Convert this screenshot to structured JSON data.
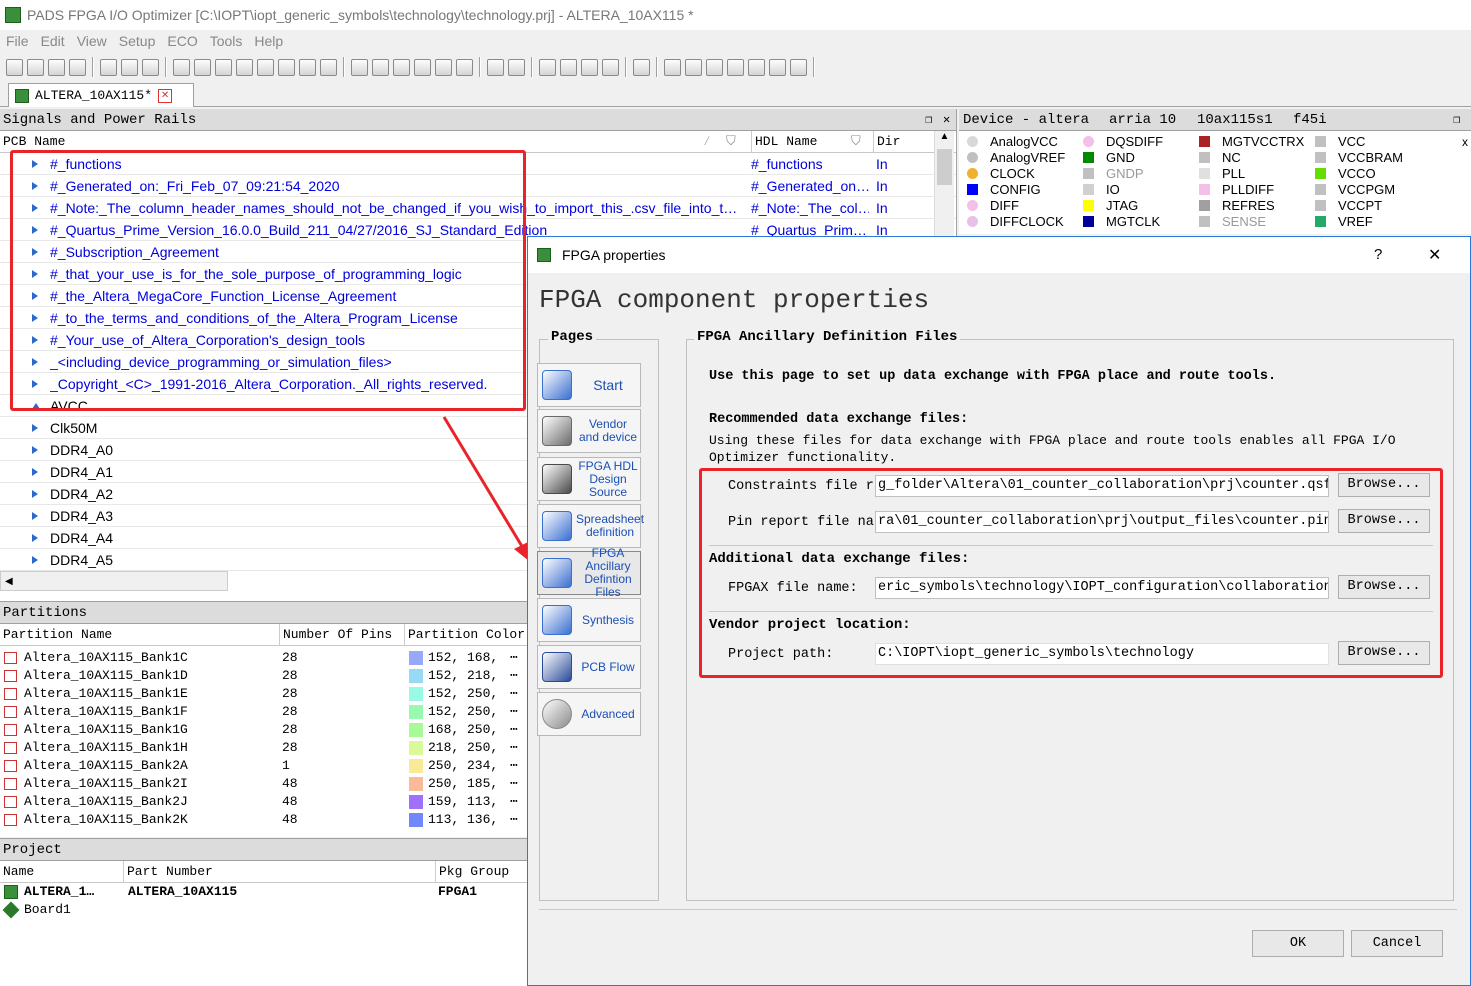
{
  "window": {
    "title": "PADS FPGA I/O Optimizer [C:\\IOPT\\iopt_generic_symbols\\technology\\technology.prj] - ALTERA_10AX115 *"
  },
  "menu": [
    "File",
    "Edit",
    "View",
    "Setup",
    "ECO",
    "Tools",
    "Help"
  ],
  "doc_tab": {
    "label": "ALTERA_10AX115*"
  },
  "signals_panel": {
    "title": "Signals and Power Rails",
    "col_pcb": "PCB Name",
    "col_hdl": "HDL Name",
    "col_dir": "Dir",
    "rows": [
      {
        "name": "#_functions",
        "hdl": "#_functions",
        "dir": "In"
      },
      {
        "name": "#_Generated_on:_Fri_Feb_07_09:21:54_2020",
        "hdl": "#_Generated_on…",
        "dir": "In"
      },
      {
        "name": "#_Note:_The_column_header_names_should_not_be_changed_if_you_wish_to_import_this_.csv_file_into_t…",
        "hdl": "#_Note:_The_col…",
        "dir": "In"
      },
      {
        "name": "#_Quartus_Prime_Version_16.0.0_Build_211_04/27/2016_SJ_Standard_Edition",
        "hdl": "#_Quartus_Prim…",
        "dir": "In"
      },
      {
        "name": "#_Subscription_Agreement",
        "hdl": "",
        "dir": ""
      },
      {
        "name": "#_that_your_use_is_for_the_sole_purpose_of_programming_logic",
        "hdl": "",
        "dir": ""
      },
      {
        "name": "#_the_Altera_MegaCore_Function_License_Agreement",
        "hdl": "",
        "dir": ""
      },
      {
        "name": "#_to_the_terms_and_conditions_of_the_Altera_Program_License",
        "hdl": "",
        "dir": ""
      },
      {
        "name": "#_Your_use_of_Altera_Corporation's_design_tools",
        "hdl": "",
        "dir": ""
      },
      {
        "name": "_<including_device_programming_or_simulation_files>",
        "hdl": "",
        "dir": ""
      },
      {
        "name": "_Copyright_<C>_1991-2016_Altera_Corporation._All_rights_reserved.",
        "hdl": "",
        "dir": ""
      },
      {
        "name": "AVCC",
        "hdl": "",
        "dir": ""
      },
      {
        "name": "Clk50M",
        "hdl": "",
        "dir": ""
      },
      {
        "name": "DDR4_A0",
        "hdl": "",
        "dir": ""
      },
      {
        "name": "DDR4_A1",
        "hdl": "",
        "dir": ""
      },
      {
        "name": "DDR4_A2",
        "hdl": "",
        "dir": ""
      },
      {
        "name": "DDR4_A3",
        "hdl": "",
        "dir": ""
      },
      {
        "name": "DDR4_A4",
        "hdl": "",
        "dir": ""
      },
      {
        "name": "DDR4_A5",
        "hdl": "",
        "dir": ""
      }
    ]
  },
  "device_panel": {
    "title": "Device - altera",
    "family": "arria 10",
    "part": "10ax115s1",
    "package": "f45i",
    "close": "x",
    "legend": [
      {
        "label": "AnalogVCC",
        "color": "#d8d8d8"
      },
      {
        "label": "AnalogVREF",
        "color": "#c0c0c0"
      },
      {
        "label": "CLOCK",
        "color": "#f0b030"
      },
      {
        "label": "CONFIG",
        "color": "#0000ff"
      },
      {
        "label": "DIFF",
        "color": "#f4c0e8"
      },
      {
        "label": "DIFFCLOCK",
        "color": "#e8c0e8"
      },
      {
        "label": "DQSDIFF",
        "color": "#f4c0e8"
      },
      {
        "label": "GND",
        "color": "#008800"
      },
      {
        "label": "GNDP",
        "color": "#c0c0c0"
      },
      {
        "label": "IO",
        "color": "#d0d0d0"
      },
      {
        "label": "JTAG",
        "color": "#ffff00"
      },
      {
        "label": "MGTCLK",
        "color": "#000099"
      },
      {
        "label": "MGTVCCTRX",
        "color": "#aa2222"
      },
      {
        "label": "NC",
        "color": "#c0c0c0"
      },
      {
        "label": "PLL",
        "color": "#e0e0e0"
      },
      {
        "label": "PLLDIFF",
        "color": "#f4c0e8"
      },
      {
        "label": "REFRES",
        "color": "#a0a0a0"
      },
      {
        "label": "SENSE",
        "color": "#c0c0c0"
      },
      {
        "label": "VCC",
        "color": "#c0c0c0"
      },
      {
        "label": "VCCBRAM",
        "color": "#c0c0c0"
      },
      {
        "label": "VCCO",
        "color": "#66dd00"
      },
      {
        "label": "VCCPGM",
        "color": "#c0c0c0"
      },
      {
        "label": "VCCPT",
        "color": "#c0c0c0"
      },
      {
        "label": "VREF",
        "color": "#22aa66"
      }
    ]
  },
  "partitions_panel": {
    "title": "Partitions",
    "col_name": "Partition Name",
    "col_pins": "Number Of Pins",
    "col_color": "Partition Color",
    "rows": [
      {
        "name": "Altera_10AX115_Bank1C",
        "pins": "28",
        "color_text": "152,  168,",
        "color": "#98a8fa"
      },
      {
        "name": "Altera_10AX115_Bank1D",
        "pins": "28",
        "color_text": "152,  218,",
        "color": "#98daf4"
      },
      {
        "name": "Altera_10AX115_Bank1E",
        "pins": "28",
        "color_text": "152,  250,",
        "color": "#98fae4"
      },
      {
        "name": "Altera_10AX115_Bank1F",
        "pins": "28",
        "color_text": "152,  250,",
        "color": "#98fab0"
      },
      {
        "name": "Altera_10AX115_Bank1G",
        "pins": "28",
        "color_text": "168,  250,",
        "color": "#a8fa98"
      },
      {
        "name": "Altera_10AX115_Bank1H",
        "pins": "28",
        "color_text": "218,  250,",
        "color": "#dafa98"
      },
      {
        "name": "Altera_10AX115_Bank2A",
        "pins": "1",
        "color_text": "250,  234,",
        "color": "#faea98"
      },
      {
        "name": "Altera_10AX115_Bank2I",
        "pins": "48",
        "color_text": "250,  185,",
        "color": "#fab998"
      },
      {
        "name": "Altera_10AX115_Bank2J",
        "pins": "48",
        "color_text": "159,  113,",
        "color": "#9f71fa"
      },
      {
        "name": "Altera_10AX115_Bank2K",
        "pins": "48",
        "color_text": "113,  136,",
        "color": "#7188fa"
      }
    ]
  },
  "project_panel": {
    "title": "Project",
    "col_name": "Name",
    "col_part": "Part Number",
    "col_pkg": "Pkg Group",
    "rows": [
      {
        "name": "ALTERA_1…",
        "part": "ALTERA_10AX115",
        "pkg": "FPGA1"
      },
      {
        "name": "Board1",
        "part": "",
        "pkg": ""
      }
    ]
  },
  "dialog": {
    "title": "FPGA properties",
    "help": "?",
    "close": "✕",
    "heading": "FPGA component properties",
    "pages_label": "Pages",
    "pages": [
      {
        "label": "Start"
      },
      {
        "label": "Vendor\nand device"
      },
      {
        "label": "FPGA HDL\nDesign\nSource"
      },
      {
        "label": "Spreadsheet\ndefinition"
      },
      {
        "label": "FPGA\nAncillary\nDefintion Files"
      },
      {
        "label": "Synthesis"
      },
      {
        "label": "PCB Flow"
      },
      {
        "label": "Advanced"
      }
    ],
    "section_title": "FPGA Ancillary Definition Files",
    "intro": "Use this page to set up data exchange with FPGA place and route tools.",
    "recommended_title": "Recommended data exchange files:",
    "recommended_desc_1": "Using these files for data exchange with FPGA place and route tools enables all FPGA I/O",
    "recommended_desc_2": "Optimizer functionality.",
    "constraints_label": "Constraints file r",
    "constraints_value": "g_folder\\Altera\\01_counter_collaboration\\prj\\counter.qsf",
    "pinreport_label": "Pin report file na",
    "pinreport_value": "ra\\01_counter_collaboration\\prj\\output_files\\counter.pin",
    "additional_title": "Additional data exchange files:",
    "fpgax_label": "FPGAX file name:",
    "fpgax_value": "eric_symbols\\technology\\IOPT_configuration\\collaboration",
    "vendor_title": "Vendor project location:",
    "project_label": "Project path:",
    "project_value": "C:\\IOPT\\iopt_generic_symbols\\technology",
    "browse": "Browse...",
    "ok": "OK",
    "cancel": "Cancel"
  },
  "colors": {
    "highlight": "#e8242a",
    "link": "#0000dd",
    "accent": "#2b78d6"
  }
}
